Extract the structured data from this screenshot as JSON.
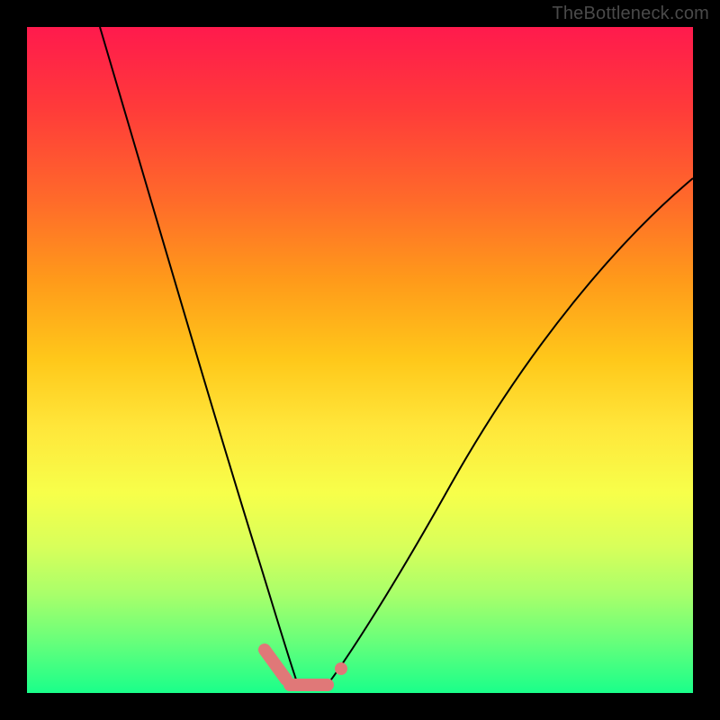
{
  "watermark": "TheBottleneck.com",
  "chart_data": {
    "type": "line",
    "title": "",
    "xlabel": "",
    "ylabel": "",
    "xlim": [
      0,
      100
    ],
    "ylim": [
      0,
      100
    ],
    "grid": false,
    "legend": false,
    "background_gradient": [
      "#ff1a4d",
      "#ff6a2a",
      "#ffc81a",
      "#f7ff4a",
      "#1aff8a"
    ],
    "series": [
      {
        "name": "left-branch",
        "x": [
          11,
          15,
          20,
          25,
          28,
          31,
          33,
          35,
          36.5,
          38,
          39,
          40
        ],
        "y": [
          100,
          80,
          58,
          38,
          27,
          18,
          12,
          7,
          4,
          2,
          1,
          0.5
        ]
      },
      {
        "name": "right-branch",
        "x": [
          45,
          47,
          50,
          55,
          62,
          72,
          84,
          100
        ],
        "y": [
          0.5,
          2,
          5,
          12,
          24,
          42,
          60,
          78
        ]
      }
    ],
    "markers": {
      "color": "#e07878",
      "segments": [
        {
          "x0": 35.5,
          "y0": 6,
          "x1": 38.5,
          "y1": 2
        },
        {
          "x0": 39,
          "y0": 1,
          "x1": 45,
          "y1": 1
        }
      ],
      "points": [
        {
          "x": 47,
          "y": 3
        }
      ]
    }
  }
}
